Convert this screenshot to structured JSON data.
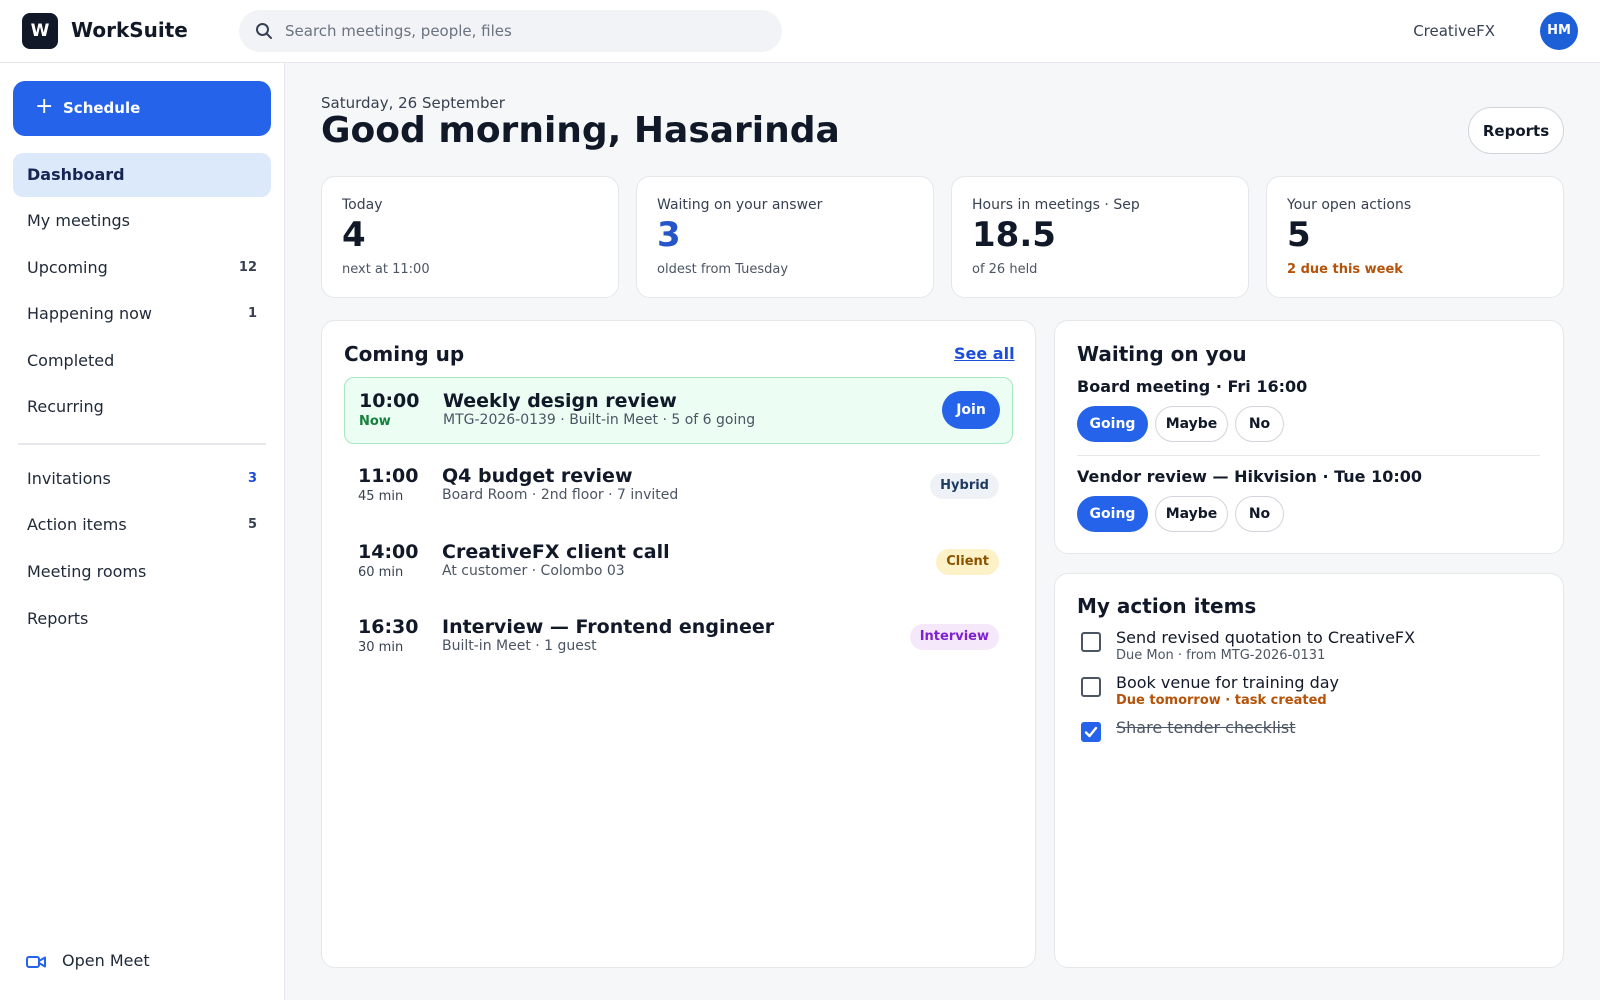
{
  "topbar": {
    "logo_letter": "W",
    "app_name": "WorkSuite",
    "search_placeholder": "Search meetings, people, files",
    "org_name": "CreativeFX",
    "avatar_initials": "HM"
  },
  "sidebar": {
    "schedule_label": "Schedule",
    "items": [
      {
        "label": "Dashboard",
        "count": "",
        "active": true
      },
      {
        "label": "My meetings",
        "count": ""
      },
      {
        "label": "Upcoming",
        "count": "12"
      },
      {
        "label": "Happening now",
        "count": "1"
      },
      {
        "label": "Completed",
        "count": ""
      },
      {
        "label": "Recurring",
        "count": ""
      },
      {
        "label": "Invitations",
        "count": "3"
      },
      {
        "label": "Action items",
        "count": "5"
      },
      {
        "label": "Meeting rooms",
        "count": ""
      },
      {
        "label": "Reports",
        "count": ""
      }
    ],
    "open_meet_label": "Open Meet"
  },
  "header": {
    "date": "Saturday, 26 September",
    "greeting": "Good morning, Hasarinda",
    "reports_label": "Reports"
  },
  "stats": [
    {
      "label": "Today",
      "value": "4",
      "sub": "next at 11:00"
    },
    {
      "label": "Waiting on your answer",
      "value": "3",
      "sub": "oldest from Tuesday"
    },
    {
      "label": "Hours in meetings · Sep",
      "value": "18.5",
      "sub": "of 26 held"
    },
    {
      "label": "Your open actions",
      "value": "5",
      "sub": "2 due this week"
    }
  ],
  "coming_up": {
    "title": "Coming up",
    "see_all": "See all",
    "meetings": [
      {
        "time": "10:00",
        "duration": "Now",
        "title": "Weekly design review",
        "meta": "MTG-2026-0139 · Built-in Meet · 5 of 6 going",
        "action": "Join"
      },
      {
        "time": "11:00",
        "duration": "45 min",
        "title": "Q4 budget review",
        "meta": "Board Room · 2nd floor · 7 invited",
        "tag": "Hybrid"
      },
      {
        "time": "14:00",
        "duration": "60 min",
        "title": "CreativeFX client call",
        "meta": "At customer · Colombo 03",
        "tag": "Client"
      },
      {
        "time": "16:30",
        "duration": "30 min",
        "title": "Interview — Frontend engineer",
        "meta": "Built-in Meet · 1 guest",
        "tag": "Interview"
      }
    ]
  },
  "waiting": {
    "title": "Waiting on you",
    "requests": [
      {
        "title": "Board meeting · Fri 16:00",
        "going": "Going",
        "maybe": "Maybe",
        "no": "No"
      },
      {
        "title": "Vendor review — Hikvision · Tue 10:00",
        "going": "Going",
        "maybe": "Maybe",
        "no": "No"
      }
    ]
  },
  "actions": {
    "title": "My action items",
    "items": [
      {
        "title": "Send revised quotation to CreativeFX",
        "sub": "Due Mon · from MTG-2026-0131",
        "done": false
      },
      {
        "title": "Book venue for training day",
        "sub": "Due tomorrow · task created",
        "done": false
      },
      {
        "title": "Share tender checklist",
        "sub": "",
        "done": true
      }
    ]
  },
  "colors": {
    "accent": "#2563eb",
    "warning": "#b45309",
    "success": "#15803d"
  }
}
